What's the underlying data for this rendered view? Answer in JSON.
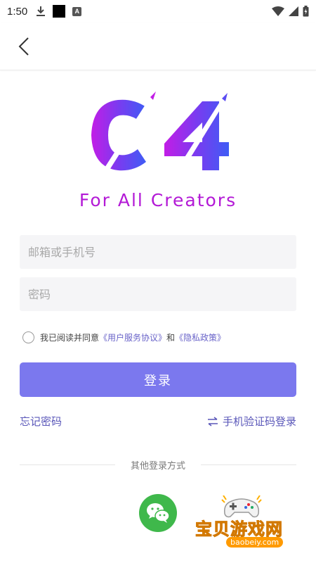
{
  "status_bar": {
    "time": "1:50",
    "a_badge": "A"
  },
  "header": {
    "back_icon": "chevron-left-icon"
  },
  "brand": {
    "logo_text": "C4",
    "tagline": "For All Creators"
  },
  "form": {
    "account_placeholder": "邮箱或手机号",
    "account_value": "",
    "password_placeholder": "密码",
    "password_value": ""
  },
  "agreement": {
    "prefix": "我已阅读并同意",
    "user_agreement": "《用户服务协议》",
    "conjunction": "和",
    "privacy_policy": "《隐私政策》",
    "checked": false
  },
  "actions": {
    "login_label": "登录",
    "forgot_password": "忘记密码",
    "sms_login": "手机验证码登录"
  },
  "other_login": {
    "label": "其他登录方式",
    "wechat_icon": "wechat-icon"
  },
  "watermark": {
    "text": "宝贝游戏网",
    "url": "baobeiy.com"
  },
  "colors": {
    "primary": "#7b78ee",
    "tagline": "#b319d6",
    "link": "#6a64c9",
    "wechat": "#3fb84b"
  }
}
